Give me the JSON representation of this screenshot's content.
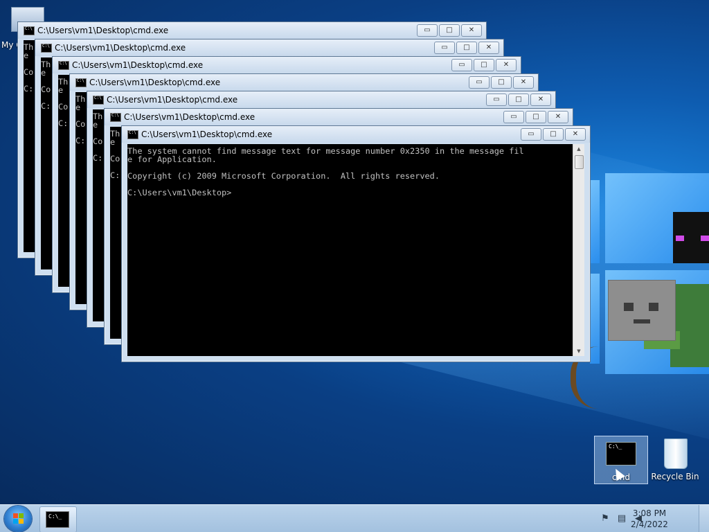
{
  "desktop": {
    "my_computer_label": "My Computer",
    "icons": [
      {
        "label": "cmd",
        "icon": "cmd-icon",
        "selected": true
      },
      {
        "label": "Recycle Bin",
        "icon": "recycle-bin-icon",
        "selected": false
      }
    ]
  },
  "windows": [
    {
      "title": "C:\\Users\\vm1\\Desktop\\cmd.exe",
      "lines": [
        "Th",
        "e",
        "",
        "Co",
        "",
        "C:"
      ]
    },
    {
      "title": "C:\\Users\\vm1\\Desktop\\cmd.exe",
      "lines": [
        "Th",
        "e",
        "",
        "Co",
        "",
        "C:"
      ]
    },
    {
      "title": "C:\\Users\\vm1\\Desktop\\cmd.exe",
      "lines": [
        "Th",
        "e",
        "",
        "Co",
        "",
        "C:"
      ]
    },
    {
      "title": "C:\\Users\\vm1\\Desktop\\cmd.exe",
      "lines": [
        "Th",
        "e",
        "",
        "Co",
        "",
        "C:"
      ]
    },
    {
      "title": "C:\\Users\\vm1\\Desktop\\cmd.exe",
      "lines": [
        "Th",
        "e",
        "",
        "Co",
        "",
        "C:"
      ]
    },
    {
      "title": "C:\\Users\\vm1\\Desktop\\cmd.exe",
      "lines": [
        "Th",
        "e",
        "",
        "Co",
        "",
        "C:"
      ]
    },
    {
      "title": "C:\\Users\\vm1\\Desktop\\cmd.exe",
      "lines": [
        "The system cannot find message text for message number 0x2350 in the message fil",
        "e for Application.",
        "",
        "Copyright (c) 2009 Microsoft Corporation.  All rights reserved.",
        "",
        "C:\\Users\\vm1\\Desktop>"
      ]
    }
  ],
  "window_buttons": {
    "minimize": "▭",
    "maximize": "□",
    "close": "✕"
  },
  "taskbar": {
    "start_label": "Start",
    "items": [
      {
        "label": "cmd.exe",
        "icon": "cmd-icon"
      }
    ],
    "tray_icons": [
      "action-center-error-icon",
      "network-icon",
      "volume-icon"
    ],
    "time": "3:08 PM",
    "date": "2/4/2022"
  }
}
